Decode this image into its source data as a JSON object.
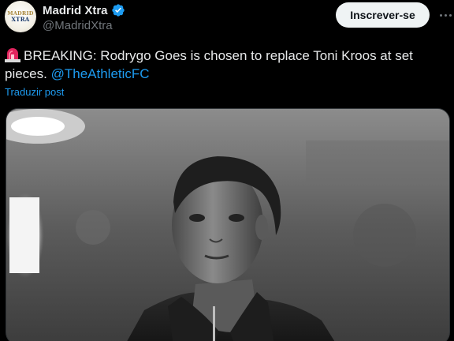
{
  "author": {
    "display_name": "Madrid Xtra",
    "handle": "@MadridXtra",
    "avatar_logo_line1": "MADRID",
    "avatar_logo_line2": "XTRA",
    "verified": true
  },
  "actions": {
    "follow_label": "Inscrever-se"
  },
  "post": {
    "text": "BREAKING: Rodrygo Goes is chosen to replace Toni Kroos at set pieces.",
    "mention": "@TheAthleticFC",
    "leading_icon": "siren-icon",
    "translate_label": "Traduzir post"
  },
  "media": {
    "type": "photo",
    "description_icon": "player-photo"
  },
  "colors": {
    "background": "#000000",
    "accent": "#1d9bf0",
    "text": "#e7e9ea",
    "muted": "#71767b",
    "follow_bg": "#eff3f4"
  }
}
